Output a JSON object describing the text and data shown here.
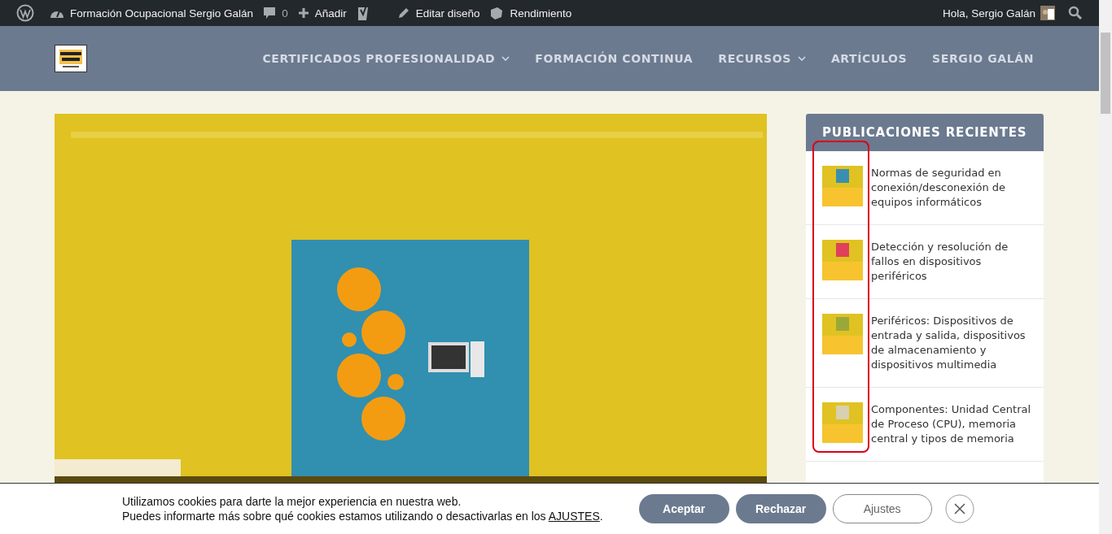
{
  "admin_bar": {
    "site_name": "Formación Ocupacional Sergio Galán",
    "comments": "0",
    "add_new": "Añadir",
    "edit_design": "Editar diseño",
    "performance": "Rendimiento",
    "greeting": "Hola, Sergio Galán"
  },
  "nav": {
    "items": [
      {
        "label": "CERTIFICADOS PROFESIONALIDAD",
        "dropdown": true
      },
      {
        "label": "FORMACIÓN CONTINUA",
        "dropdown": false
      },
      {
        "label": "RECURSOS",
        "dropdown": true
      },
      {
        "label": "ARTÍCULOS",
        "dropdown": false
      },
      {
        "label": "SERGIO GALÁN",
        "dropdown": false
      }
    ]
  },
  "sidebar": {
    "title": "PUBLICACIONES RECIENTES",
    "posts": [
      {
        "title": "Normas de seguridad en conexión/desconexión de equipos informáticos",
        "color": "#3a8fb0"
      },
      {
        "title": "Detección y resolución de fallos en dispositivos periféricos",
        "color": "#e0405a"
      },
      {
        "title": "Periféricos: Dispositivos de entrada y salida, dispositivos de almacenamiento y dispositivos multimedia",
        "color": "#9aa83a"
      },
      {
        "title": "Componentes: Unidad Central de Proceso (CPU), memoria central y tipos de memoria",
        "color": "#d8d0b0"
      }
    ]
  },
  "cookie_bar": {
    "line_1": "Utilizamos cookies para darte la mejor experiencia en nuestra web.",
    "line_2": "Puedes informarte más sobre qué cookies estamos utilizando o desactivarlas en los",
    "link": "AJUSTES",
    "line_end": ".",
    "buttons": [
      {
        "label": "Aceptar",
        "kind": "filled"
      },
      {
        "label": "Rechazar",
        "kind": "filled"
      },
      {
        "label": "Ajustes",
        "kind": "outline"
      }
    ]
  }
}
